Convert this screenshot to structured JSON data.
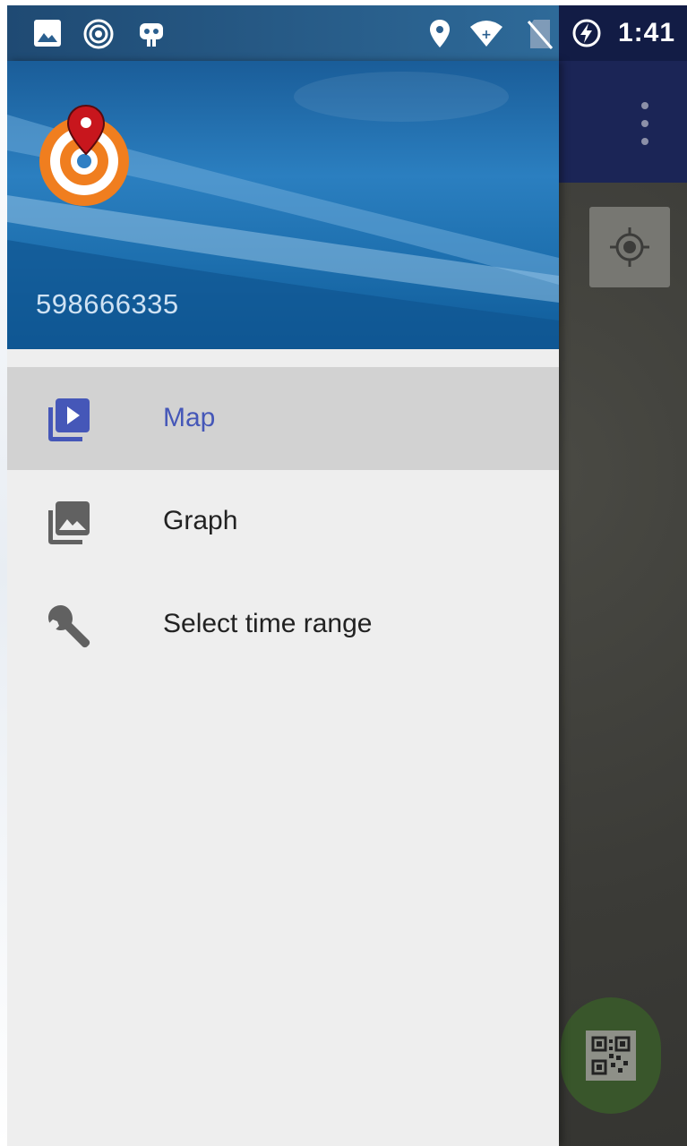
{
  "status_bar": {
    "time": "1:41",
    "left_icons": [
      "image-icon",
      "radar-icon",
      "robot-icon"
    ],
    "right_icons": [
      "location-pin-icon",
      "wifi-icon",
      "no-sim-icon",
      "battery-charging-icon"
    ]
  },
  "drawer": {
    "account_id": "598666335",
    "items": [
      {
        "label": "Map",
        "icon": "video-library-icon",
        "selected": true
      },
      {
        "label": "Graph",
        "icon": "photo-library-icon",
        "selected": false
      },
      {
        "label": "Select time range",
        "icon": "wrench-icon",
        "selected": false
      }
    ]
  },
  "colors": {
    "accent": "#4557b8",
    "header_blue": "#1d6fae",
    "app_bar": "#1b2556",
    "fab": "#39562b"
  }
}
